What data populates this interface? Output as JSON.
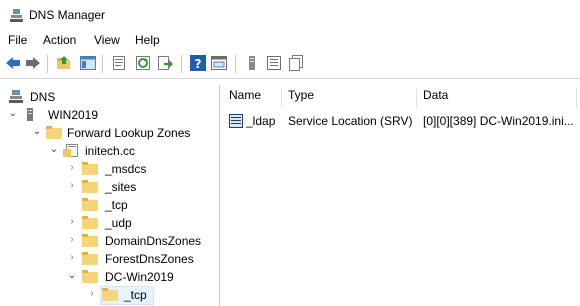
{
  "window": {
    "title": "DNS Manager",
    "app_icon": "dns-manager-icon"
  },
  "menu": [
    {
      "label": "File"
    },
    {
      "label": "Action"
    },
    {
      "label": "View"
    },
    {
      "label": "Help"
    }
  ],
  "toolbar": {
    "buttons": [
      "back-icon",
      "forward-icon",
      "up-folder-icon",
      "show-hide-tree-icon",
      "properties-icon",
      "refresh-icon",
      "export-list-icon",
      "help-icon",
      "console-tree-icon",
      "server-icon",
      "list-icon",
      "copy-icon"
    ]
  },
  "tree": {
    "items": [
      {
        "label": "DNS"
      },
      {
        "label": "WIN2019"
      },
      {
        "label": "Forward Lookup Zones"
      },
      {
        "label": "initech.cc"
      },
      {
        "label": "_msdcs"
      },
      {
        "label": "_sites"
      },
      {
        "label": "_tcp"
      },
      {
        "label": "_udp"
      },
      {
        "label": "DomainDnsZones"
      },
      {
        "label": "ForestDnsZones"
      },
      {
        "label": "DC-Win2019"
      },
      {
        "label": "_tcp"
      }
    ]
  },
  "list": {
    "columns": [
      "Name",
      "Type",
      "Data"
    ],
    "rows": [
      {
        "name": "_ldap",
        "type": "Service Location (SRV)",
        "data": "[0][0][389] DC-Win2019.ini..."
      }
    ]
  },
  "colors": {
    "selection": "#e5f3ff",
    "folder": "#f0c75e",
    "accent": "#1f7bd1"
  }
}
